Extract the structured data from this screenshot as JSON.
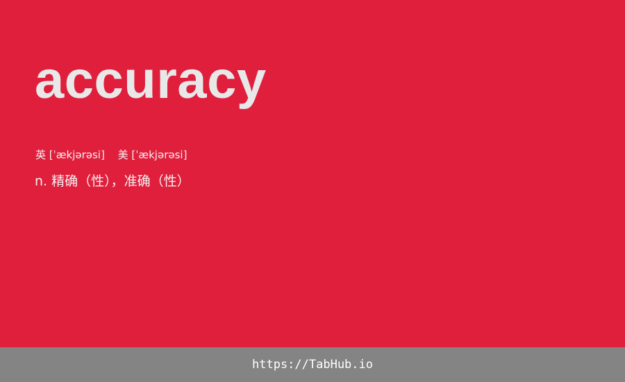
{
  "word": "accuracy",
  "pronunciation": {
    "uk_label": "英",
    "uk_ipa": "[ˈækjərəsi]",
    "us_label": "美",
    "us_ipa": "[ˈækjərəsi]"
  },
  "definition": "n. 精确（性），准确（性）",
  "footer": {
    "link": "https://TabHub.io"
  },
  "colors": {
    "background": "#e01f3d",
    "word_text": "#e8e8e8",
    "footer_background": "#848484"
  }
}
